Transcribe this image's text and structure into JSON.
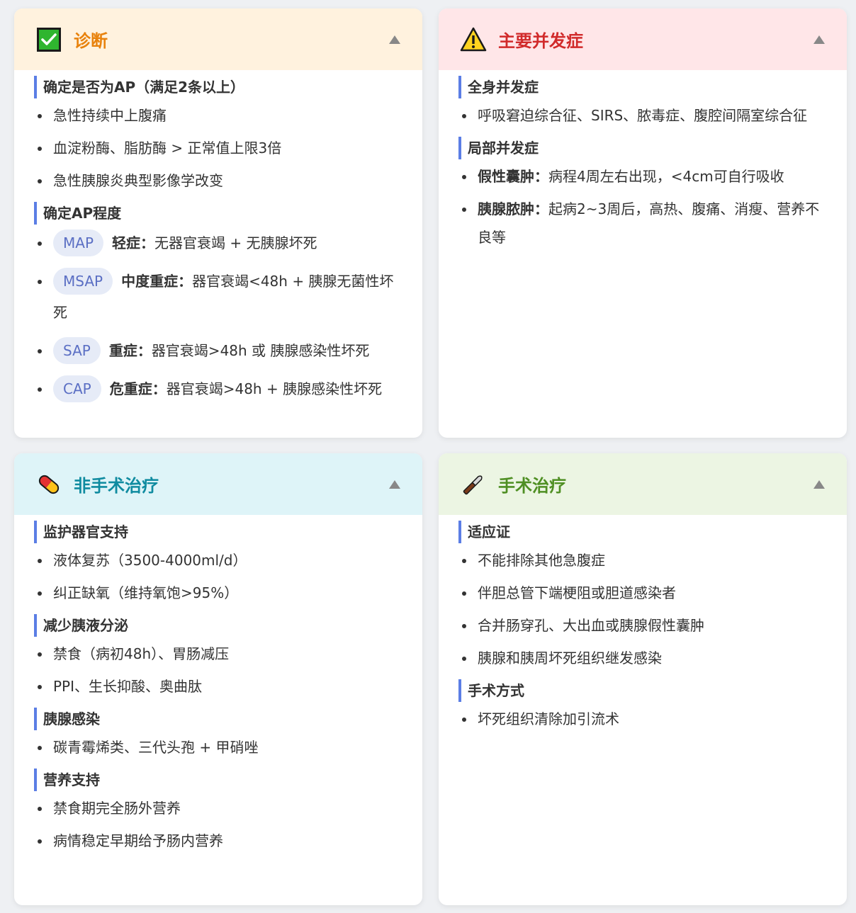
{
  "colors": {
    "accent_bar": "#5b7ee5",
    "tag_bg": "#e6ebf7",
    "tag_text": "#5b6fc4"
  },
  "cards": {
    "diagnosis": {
      "title": "诊断",
      "icon": "check-box-icon",
      "header_bg": "#fff2de",
      "title_color": "#e8820c",
      "sections": {
        "ap_confirm": {
          "title": "确定是否为AP（满足2条以上）",
          "items": [
            "急性持续中上腹痛",
            "血淀粉酶、脂肪酶 > 正常值上限3倍",
            "急性胰腺炎典型影像学改变"
          ]
        },
        "ap_severity": {
          "title": "确定AP程度",
          "items": [
            {
              "tag": "MAP",
              "label": "轻症",
              "text": "无器官衰竭 + 无胰腺坏死"
            },
            {
              "tag": "MSAP",
              "label": "中度重症",
              "text": "器官衰竭<48h + 胰腺无菌性坏死"
            },
            {
              "tag": "SAP",
              "label": "重症",
              "text": "器官衰竭>48h 或 胰腺感染性坏死"
            },
            {
              "tag": "CAP",
              "label": "危重症",
              "text": "器官衰竭>48h + 胰腺感染性坏死"
            }
          ]
        }
      }
    },
    "complications": {
      "title": "主要并发症",
      "icon": "warning-icon",
      "header_bg": "#ffe6e8",
      "title_color": "#d12a2a",
      "sections": {
        "systemic": {
          "title": "全身并发症",
          "items": [
            "呼吸窘迫综合征、SIRS、脓毒症、腹腔间隔室综合征"
          ]
        },
        "local": {
          "title": "局部并发症",
          "items": [
            {
              "label": "假性囊肿",
              "text": "病程4周左右出现，<4cm可自行吸收"
            },
            {
              "label": "胰腺脓肿",
              "text": "起病2~3周后，高热、腹痛、消瘦、营养不良等"
            }
          ]
        }
      }
    },
    "nonsurgical": {
      "title": "非手术治疗",
      "icon": "pill-icon",
      "header_bg": "#def4f8",
      "title_color": "#0f8ba0",
      "sections": {
        "organ_support": {
          "title": "监护器官支持",
          "items": [
            "液体复苏（3500-4000ml/d）",
            "纠正缺氧（维持氧饱>95%）"
          ]
        },
        "reduce_secretion": {
          "title": "减少胰液分泌",
          "items": [
            "禁食（病初48h）、胃肠减压",
            "PPI、生长抑酸、奥曲肽"
          ]
        },
        "infection": {
          "title": "胰腺感染",
          "items": [
            "碳青霉烯类、三代头孢 + 甲硝唑"
          ]
        },
        "nutrition": {
          "title": "营养支持",
          "items": [
            "禁食期完全肠外营养",
            "病情稳定早期给予肠内营养"
          ]
        }
      }
    },
    "surgical": {
      "title": "手术治疗",
      "icon": "scalpel-icon",
      "header_bg": "#ecf5e3",
      "title_color": "#4f8f23",
      "sections": {
        "indications": {
          "title": "适应证",
          "items": [
            "不能排除其他急腹症",
            "伴胆总管下端梗阻或胆道感染者",
            "合并肠穿孔、大出血或胰腺假性囊肿",
            "胰腺和胰周坏死组织继发感染"
          ]
        },
        "methods": {
          "title": "手术方式",
          "items": [
            "坏死组织清除加引流术"
          ]
        }
      }
    }
  }
}
